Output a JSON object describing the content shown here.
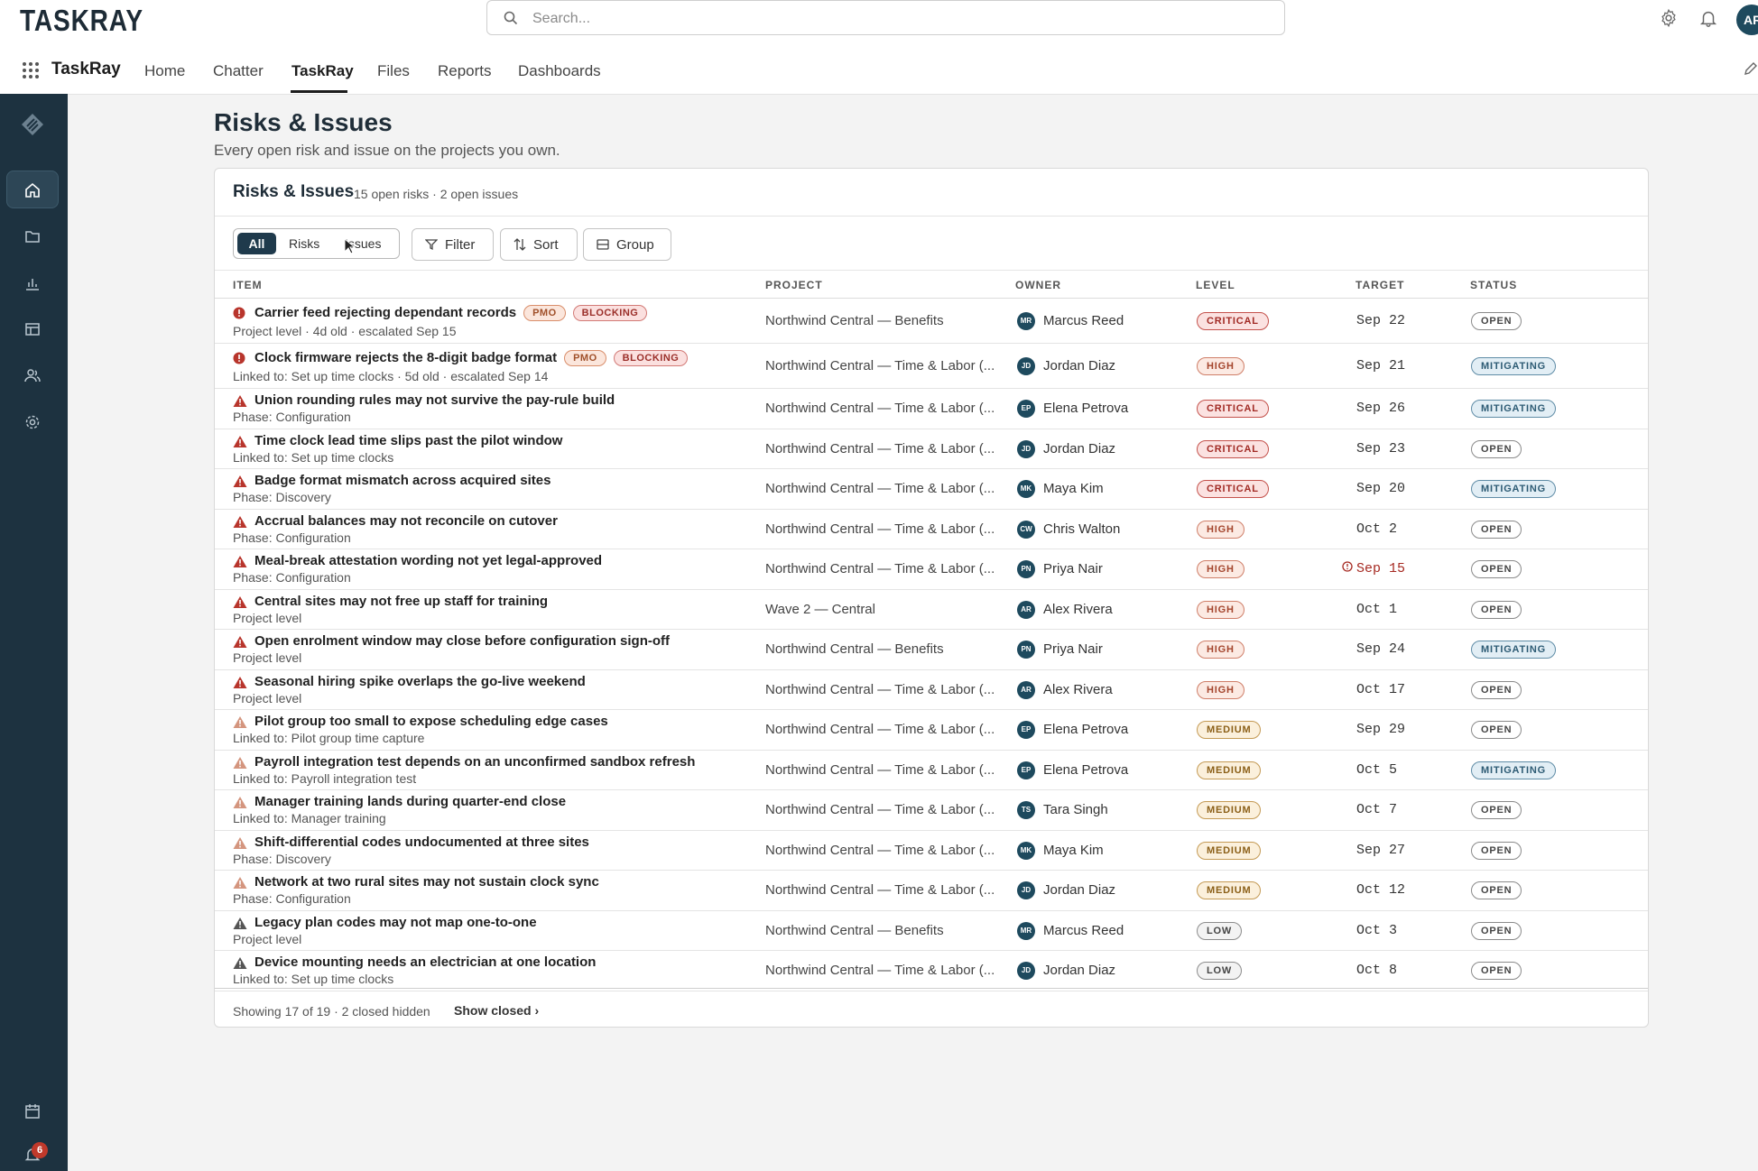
{
  "header": {
    "logo_text": "TASKRAY",
    "search_placeholder": "Search...",
    "avatar_initials": "AR"
  },
  "nav": {
    "app_name": "TaskRay",
    "items": [
      "Home",
      "Chatter",
      "TaskRay",
      "Files",
      "Reports",
      "Dashboards"
    ],
    "active": "TaskRay"
  },
  "sidebar": {
    "icons": [
      "logo-icon",
      "home-icon",
      "folder-icon",
      "bar-chart-icon",
      "table-icon",
      "people-icon",
      "settings-icon",
      "calendar-icon",
      "bell-icon"
    ],
    "notification_count": "6"
  },
  "page": {
    "title": "Risks & Issues",
    "subtitle": "Every open risk and issue on the projects you own."
  },
  "card": {
    "title": "Risks & Issues",
    "count_text": "15 open risks · 2 open issues",
    "segments": [
      "All",
      "Risks",
      "Issues"
    ],
    "selected_segment": "All",
    "toolbar": {
      "filter": "Filter",
      "sort": "Sort",
      "group": "Group"
    },
    "columns": [
      "ITEM",
      "PROJECT",
      "OWNER",
      "LEVEL",
      "TARGET",
      "STATUS"
    ],
    "rows": [
      {
        "type": "issue",
        "title": "Carrier feed rejecting dependant records",
        "tags": [
          "PMO",
          "BLOCKING"
        ],
        "meta": "Project level · 4d old · escalated Sep  15",
        "project": "Northwind Central — Benefits",
        "owner_initials": "MR",
        "owner": "Marcus Reed",
        "level": "CRITICAL",
        "target": "Sep 22",
        "status": "OPEN"
      },
      {
        "type": "issue",
        "title": "Clock firmware rejects the 8-digit badge format",
        "tags": [
          "PMO",
          "BLOCKING"
        ],
        "meta": "Linked to: Set up time clocks · 5d old · escalated Sep  14",
        "project": "Northwind Central — Time & Labor (...",
        "owner_initials": "JD",
        "owner": "Jordan Diaz",
        "level": "HIGH",
        "target": "Sep 21",
        "status": "MITIGATING"
      },
      {
        "type": "risk",
        "title": "Union rounding rules may not survive the pay-rule build",
        "tags": [],
        "meta": "Phase: Configuration",
        "project": "Northwind Central — Time & Labor (...",
        "owner_initials": "EP",
        "owner": "Elena Petrova",
        "level": "CRITICAL",
        "target": "Sep 26",
        "status": "MITIGATING"
      },
      {
        "type": "risk",
        "title": "Time clock lead time slips past the pilot window",
        "tags": [],
        "meta": "Linked to: Set up time clocks",
        "project": "Northwind Central — Time & Labor (...",
        "owner_initials": "JD",
        "owner": "Jordan Diaz",
        "level": "CRITICAL",
        "target": "Sep 23",
        "status": "OPEN"
      },
      {
        "type": "risk",
        "title": "Badge format mismatch across acquired sites",
        "tags": [],
        "meta": "Phase: Discovery",
        "project": "Northwind Central — Time & Labor (...",
        "owner_initials": "MK",
        "owner": "Maya Kim",
        "level": "CRITICAL",
        "target": "Sep 20",
        "status": "MITIGATING"
      },
      {
        "type": "risk",
        "title": "Accrual balances may not reconcile on cutover",
        "tags": [],
        "meta": "Phase: Configuration",
        "project": "Northwind Central — Time & Labor (...",
        "owner_initials": "CW",
        "owner": "Chris Walton",
        "level": "HIGH",
        "target": "Oct 2",
        "status": "OPEN"
      },
      {
        "type": "risk",
        "title": "Meal-break attestation wording not yet legal-approved",
        "tags": [],
        "meta": "Phase: Configuration",
        "project": "Northwind Central — Time & Labor (...",
        "owner_initials": "PN",
        "owner": "Priya Nair",
        "level": "HIGH",
        "target": "Sep 15",
        "overdue": true,
        "status": "OPEN"
      },
      {
        "type": "risk",
        "title": "Central sites may not free up staff for training",
        "tags": [],
        "meta": "Project level",
        "project": "Wave 2 — Central",
        "owner_initials": "AR",
        "owner": "Alex Rivera",
        "level": "HIGH",
        "target": "Oct 1",
        "status": "OPEN"
      },
      {
        "type": "risk",
        "title": "Open enrolment window may close before configuration sign-off",
        "tags": [],
        "meta": "Project level",
        "project": "Northwind Central — Benefits",
        "owner_initials": "PN",
        "owner": "Priya Nair",
        "level": "HIGH",
        "target": "Sep 24",
        "status": "MITIGATING"
      },
      {
        "type": "risk",
        "title": "Seasonal hiring spike overlaps the go-live weekend",
        "tags": [],
        "meta": "Project level",
        "project": "Northwind Central — Time & Labor (...",
        "owner_initials": "AR",
        "owner": "Alex Rivera",
        "level": "HIGH",
        "target": "Oct 17",
        "status": "OPEN"
      },
      {
        "type": "risk",
        "title": "Pilot group too small to expose scheduling edge cases",
        "tags": [],
        "meta": "Linked to: Pilot group time capture",
        "project": "Northwind Central — Time & Labor (...",
        "owner_initials": "EP",
        "owner": "Elena Petrova",
        "level": "MEDIUM",
        "target": "Sep 29",
        "status": "OPEN"
      },
      {
        "type": "risk",
        "title": "Payroll integration test depends on an unconfirmed sandbox refresh",
        "tags": [],
        "meta": "Linked to: Payroll integration test",
        "project": "Northwind Central — Time & Labor (...",
        "owner_initials": "EP",
        "owner": "Elena Petrova",
        "level": "MEDIUM",
        "target": "Oct 5",
        "status": "MITIGATING"
      },
      {
        "type": "risk",
        "title": "Manager training lands during quarter-end close",
        "tags": [],
        "meta": "Linked to: Manager training",
        "project": "Northwind Central — Time & Labor (...",
        "owner_initials": "TS",
        "owner": "Tara Singh",
        "level": "MEDIUM",
        "target": "Oct 7",
        "status": "OPEN"
      },
      {
        "type": "risk",
        "title": "Shift-differential codes undocumented at three sites",
        "tags": [],
        "meta": "Phase: Discovery",
        "project": "Northwind Central — Time & Labor (...",
        "owner_initials": "MK",
        "owner": "Maya Kim",
        "level": "MEDIUM",
        "target": "Sep 27",
        "status": "OPEN"
      },
      {
        "type": "risk",
        "title": "Network at two rural sites may not sustain clock sync",
        "tags": [],
        "meta": "Phase: Configuration",
        "project": "Northwind Central — Time & Labor (...",
        "owner_initials": "JD",
        "owner": "Jordan Diaz",
        "level": "MEDIUM",
        "target": "Oct 12",
        "status": "OPEN"
      },
      {
        "type": "risk",
        "title": "Legacy plan codes may not map one-to-one",
        "tags": [],
        "meta": "Project level",
        "project": "Northwind Central — Benefits",
        "owner_initials": "MR",
        "owner": "Marcus Reed",
        "level": "LOW",
        "target": "Oct 3",
        "status": "OPEN"
      },
      {
        "type": "risk",
        "title": "Device mounting needs an electrician at one location",
        "tags": [],
        "meta": "Linked to: Set up time clocks",
        "project": "Northwind Central — Time & Labor (...",
        "owner_initials": "JD",
        "owner": "Jordan Diaz",
        "level": "LOW",
        "target": "Oct 8",
        "status": "OPEN"
      }
    ],
    "footer_text": "Showing 17 of 19 · 2 closed hidden",
    "footer_link": "Show closed ›"
  },
  "colors": {
    "sidebar": "#1d3240",
    "critical": "#a12a24",
    "high_icon": "#b8352c",
    "medium_icon": "#d4957e",
    "low_icon": "#555555",
    "mitigating": "#2d5b74"
  }
}
